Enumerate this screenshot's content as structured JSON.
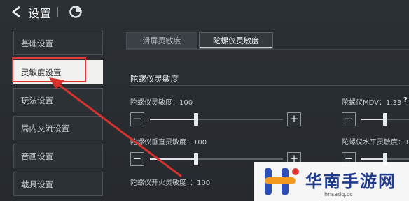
{
  "header": {
    "title": "设置"
  },
  "sidebar": {
    "items": [
      {
        "label": "基础设置"
      },
      {
        "label": "灵敏度设置"
      },
      {
        "label": "玩法设置"
      },
      {
        "label": "局内交流设置"
      },
      {
        "label": "音画设置"
      },
      {
        "label": "载具设置"
      }
    ],
    "active_index": 1
  },
  "tabs": [
    {
      "label": "滑屏灵敏度"
    },
    {
      "label": "陀螺仪灵敏度"
    }
  ],
  "section": {
    "title": "陀螺仪灵敏度"
  },
  "settings": {
    "gyro_sens": {
      "label": "陀螺仪灵敏度：100",
      "value": 100
    },
    "gyro_mdv": {
      "label": "陀螺仪MDV：1.33",
      "help": "?"
    },
    "gyro_vertical": {
      "label": "陀螺仪垂直灵敏度：100",
      "value": 100
    },
    "gyro_horizontal": {
      "label": "陀螺仪水平灵敏度：100",
      "value": 100
    },
    "gyro_fire": {
      "label": "陀螺仪开火灵敏度：：100",
      "value": 100
    }
  },
  "controls": {
    "minus": "−",
    "plus": "+"
  },
  "watermark": {
    "title": "华南手游网",
    "url": "hnsadq.cc"
  },
  "colors": {
    "highlight": "#e23a36",
    "active_bg": "#f0f0ee",
    "brand": "#1f3b8a"
  }
}
